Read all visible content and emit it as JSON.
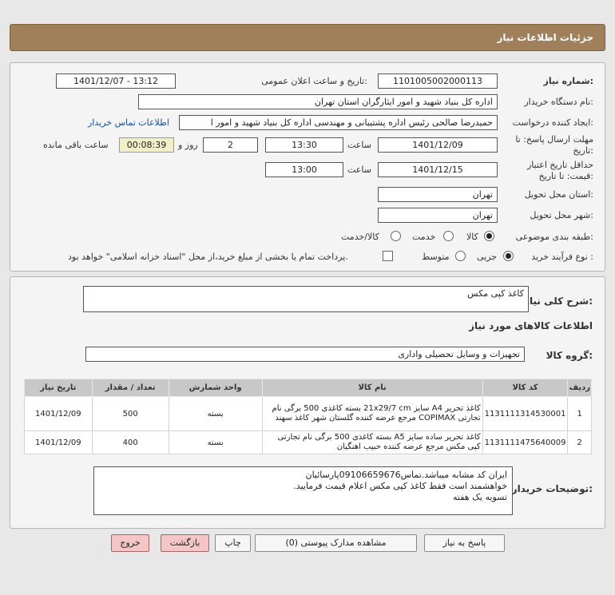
{
  "header": {
    "title": "جزئیات اطلاعات نیاز"
  },
  "form": {
    "need_number_label": "شماره نیاز:",
    "need_number": "1101005002000113",
    "announce_label": "تاریخ و ساعت اعلان عمومی:",
    "announce_value": "1401/12/07 - 13:12",
    "buyer_label": "نام دستگاه خریدار:",
    "buyer_value": "اداره کل بنیاد شهید و امور ایثارگران استان تهران",
    "creator_label": "ایجاد کننده درخواست:",
    "creator_value": "حمیدرضا صالحی رئیس اداره پشتیبانی و مهندسی اداره کل بنیاد شهید و امور ا",
    "contact_link": "اطلاعات تماس خریدار",
    "reply_deadline_label": "مهلت ارسال پاسخ: تا تاریخ:",
    "reply_date": "1401/12/09",
    "time_label": "ساعت",
    "reply_time": "13:30",
    "day_count": "2",
    "day_label": "روز و",
    "remaining_time": "00:08:39",
    "remaining_label": "ساعت باقی مانده",
    "validity_label": "حداقل تاریخ اعتبار قیمت: تا تاریخ:",
    "validity_date": "1401/12/15",
    "validity_time_label": "ساعت",
    "validity_time": "13:00",
    "province_label": "استان محل تحویل:",
    "province_value": "تهران",
    "city_label": "شهر محل تحویل:",
    "city_value": "تهران",
    "category_label": "طبقه بندی موضوعی:",
    "category_options": [
      "کالا",
      "خدمت",
      "کالا/خدمت"
    ],
    "process_label": "نوع فرآیند خرید :",
    "process_options": [
      "جزیی",
      "متوسط"
    ],
    "payment_note": "پرداخت تمام یا بخشی از مبلغ خرید،از محل \"اسناد خزانه اسلامی\" خواهد بود."
  },
  "summary": {
    "label": "شرح کلی نیاز:",
    "value": "کاغذ کپی مکس"
  },
  "goods": {
    "section_title": "اطلاعات کالاهای مورد نیاز",
    "group_label": "گروه کالا:",
    "group_value": "تجهیزات و وسایل تحصیلی واداری",
    "columns": [
      "ردیف",
      "کد کالا",
      "نام کالا",
      "واحد شمارش",
      "تعداد / مقدار",
      "تاریخ نیاز"
    ],
    "rows": [
      {
        "row": "1",
        "code": "1131111314530001",
        "name": "کاغذ تحریر A4 سایز 21x29/7 cm بسته کاغذی 500 برگی نام تجارتی COPIMAX مرجع عرضه کننده گلستان شهر کاغذ سهند",
        "unit": "بسته",
        "qty": "500",
        "date": "1401/12/09"
      },
      {
        "row": "2",
        "code": "1131111475640009",
        "name": "کاغذ تحریر ساده سایز A5 بسته کاغذی 500 برگی نام تجارتی کپی مکس مرجع عرضه کننده حبیب اهنگیان",
        "unit": "بسته",
        "qty": "400",
        "date": "1401/12/09"
      }
    ]
  },
  "buyer_notes": {
    "label": "توضیحات خریدار:",
    "lines": [
      "ایران کد مشابه میباشد.تماس09106659676پارسائیان",
      "خواهشمند است فقط کاغذ کپی مکس اعلام قیمت فرمایید.",
      "تسویه یک هفته"
    ]
  },
  "buttons": {
    "reply": "پاسخ به نیاز",
    "attachments": "مشاهده مدارک پیوستی (0)",
    "print": "چاپ",
    "back": "بازگشت",
    "exit": "خروج"
  },
  "colors": {
    "header": "#a0805a",
    "remaining_bg": "#f1efc6",
    "exit_bg": "#f5c6c6"
  }
}
